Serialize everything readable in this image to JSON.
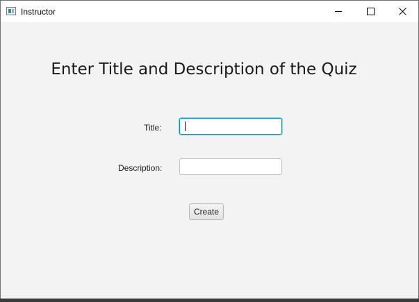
{
  "window": {
    "title": "Instructor",
    "icon": "java-app-icon",
    "controls": [
      "minimize-icon",
      "maximize-icon",
      "close-icon"
    ]
  },
  "form": {
    "heading": "Enter Title and Description of the Quiz",
    "title_label": "Title:",
    "title_value": "",
    "description_label": "Description:",
    "description_value": "",
    "create_label": "Create"
  },
  "colors": {
    "focus_border": "#0096c9",
    "window_bg": "#f3f3f3"
  }
}
